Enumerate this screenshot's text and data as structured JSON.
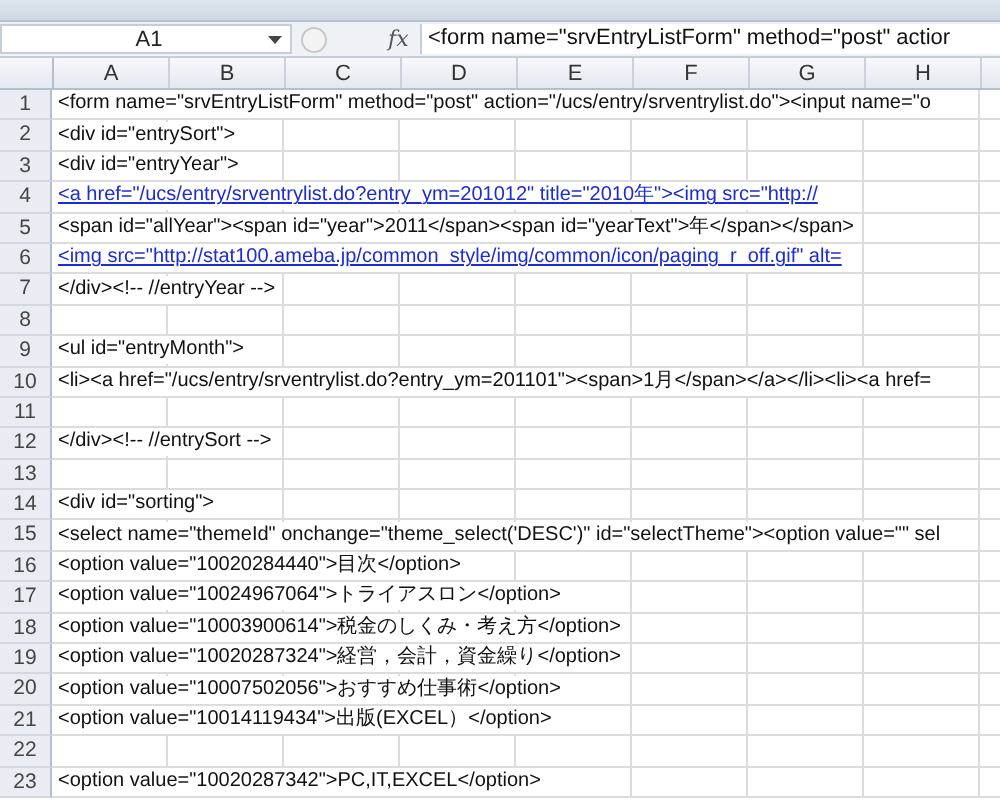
{
  "formula_bar": {
    "name_box": "A1",
    "function_label": "fx",
    "formula": "<form name=\"srvEntryListForm\" method=\"post\" actior"
  },
  "columns": [
    "A",
    "B",
    "C",
    "D",
    "E",
    "F",
    "G",
    "H"
  ],
  "rows": [
    {
      "number": "1",
      "kind": "text",
      "text": "<form name=\"srvEntryListForm\" method=\"post\" action=\"/ucs/entry/srventrylist.do\"><input name=\"o"
    },
    {
      "number": "2",
      "kind": "text",
      "text": "<div id=\"entrySort\">"
    },
    {
      "number": "3",
      "kind": "text",
      "text": "<div id=\"entryYear\">"
    },
    {
      "number": "4",
      "kind": "link",
      "text": "<a href=\"/ucs/entry/srventrylist.do?entry_ym=201012\" title=\"2010年\"><img src=\"http://"
    },
    {
      "number": "5",
      "kind": "text",
      "text": "<span id=\"allYear\"><span id=\"year\">2011</span><span id=\"yearText\">年</span></span>"
    },
    {
      "number": "6",
      "kind": "link",
      "text": "<img src=\"http://stat100.ameba.jp/common_style/img/common/icon/paging_r_off.gif\" alt="
    },
    {
      "number": "7",
      "kind": "text",
      "text": "</div><!-- //entryYear -->"
    },
    {
      "number": "8"
    },
    {
      "number": "9",
      "kind": "text",
      "text": "<ul id=\"entryMonth\">"
    },
    {
      "number": "10",
      "kind": "text",
      "text": "<li><a href=\"/ucs/entry/srventrylist.do?entry_ym=201101\"><span>1月</span></a></li><li><a href="
    },
    {
      "number": "11"
    },
    {
      "number": "12",
      "kind": "text",
      "text": "</div><!-- //entrySort -->"
    },
    {
      "number": "13"
    },
    {
      "number": "14",
      "kind": "text",
      "text": "<div id=\"sorting\">"
    },
    {
      "number": "15",
      "kind": "text",
      "text": "<select name=\"themeId\" onchange=\"theme_select('DESC')\" id=\"selectTheme\"><option value=\"\" sel"
    },
    {
      "number": "16",
      "kind": "text",
      "text": "<option value=\"10020284440\">目次</option>"
    },
    {
      "number": "17",
      "kind": "text",
      "text": "<option value=\"10024967064\">トライアスロン</option>"
    },
    {
      "number": "18",
      "kind": "text",
      "text": "<option value=\"10003900614\">税金のしくみ・考え方</option>"
    },
    {
      "number": "19",
      "kind": "text",
      "text": "<option value=\"10020287324\">経営，会計，資金繰り</option>"
    },
    {
      "number": "20",
      "kind": "text",
      "text": "<option value=\"10007502056\">おすすめ仕事術</option>"
    },
    {
      "number": "21",
      "kind": "text",
      "text": "<option value=\"10014119434\">出版(EXCEL）</option>"
    },
    {
      "number": "22"
    },
    {
      "number": "23",
      "kind": "text",
      "text": "<option value=\"10020287342\">PC,IT,EXCEL</option>"
    }
  ]
}
